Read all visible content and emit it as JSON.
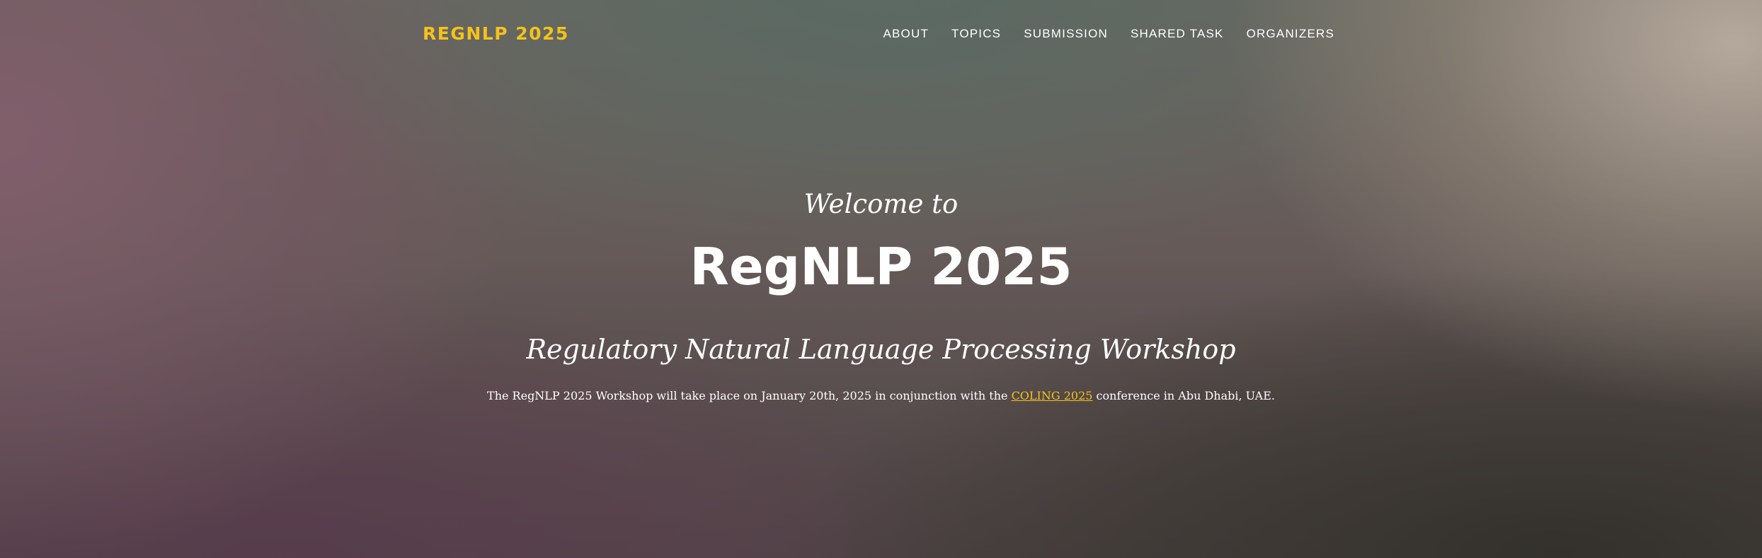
{
  "header": {
    "brand": "REGNLP 2025",
    "nav": [
      {
        "label": "ABOUT"
      },
      {
        "label": "TOPICS"
      },
      {
        "label": "SUBMISSION"
      },
      {
        "label": "SHARED TASK"
      },
      {
        "label": "ORGANIZERS"
      }
    ]
  },
  "hero": {
    "welcome": "Welcome to",
    "title": "RegNLP 2025",
    "subtitle": "Regulatory Natural Language Processing Workshop",
    "description_before": "The RegNLP 2025 Workshop will take place on January 20th, 2025 in conjunction with the ",
    "description_link": "COLING 2025",
    "description_after": " conference in Abu Dhabi, UAE."
  },
  "colors": {
    "accent": "#f5c21b",
    "text": "#ffffff"
  }
}
